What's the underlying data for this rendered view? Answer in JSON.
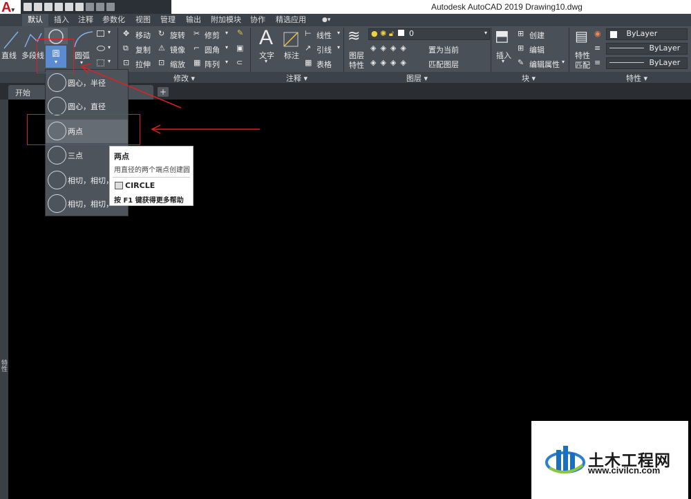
{
  "window": {
    "title": "Autodesk AutoCAD 2019    Drawing10.dwg",
    "logo": "A"
  },
  "tabs": [
    "默认",
    "插入",
    "注释",
    "参数化",
    "视图",
    "管理",
    "输出",
    "附加模块",
    "协作",
    "精选应用"
  ],
  "draw_panel": {
    "line": "直线",
    "polyline": "多段线",
    "circle": "圆",
    "arc": "圆弧"
  },
  "modify_panel": {
    "label": "修改 ▾",
    "move": "移动",
    "rotate": "旋转",
    "trim": "修剪",
    "copy": "复制",
    "mirror": "镜像",
    "fillet": "圆角",
    "stretch": "拉伸",
    "scale": "缩放",
    "array": "阵列"
  },
  "annotation_panel": {
    "label": "注释 ▾",
    "text": "文字",
    "dimension": "标注",
    "linetype": "线性",
    "leader": "引线",
    "table": "表格"
  },
  "layers_panel": {
    "label": "图层 ▾",
    "layer_props_1": "图层",
    "layer_props_2": "特性",
    "current_layer": "0",
    "set_current": "置为当前",
    "match_layer": "匹配图层"
  },
  "block_panel": {
    "label": "块 ▾",
    "insert": "插入",
    "create": "创建",
    "edit": "编辑",
    "edit_attr": "编辑属性"
  },
  "props_panel": {
    "label": "特性 ▾",
    "match_1": "特性",
    "match_2": "匹配",
    "color": "ByLayer",
    "linetype": "ByLayer",
    "lineweight": "ByLayer"
  },
  "doc_tabs": {
    "start": "开始",
    "plus": "+"
  },
  "dropdown": {
    "items": [
      "圆心，半径",
      "圆心，直径",
      "两点",
      "三点",
      "相切，相切，",
      "相切，相切，"
    ]
  },
  "tooltip": {
    "title": "两点",
    "desc": "用直径的两个端点创建圆",
    "command": "CIRCLE",
    "help": "按 F1 键获得更多帮助"
  },
  "side_label": "特性",
  "watermark": {
    "cn": "土木工程网",
    "url": "www.civilcn.com"
  },
  "colors": {
    "accent_red": "#e02020",
    "ribbon": "#4a5058",
    "selected_blue": "#5b8bd1"
  }
}
